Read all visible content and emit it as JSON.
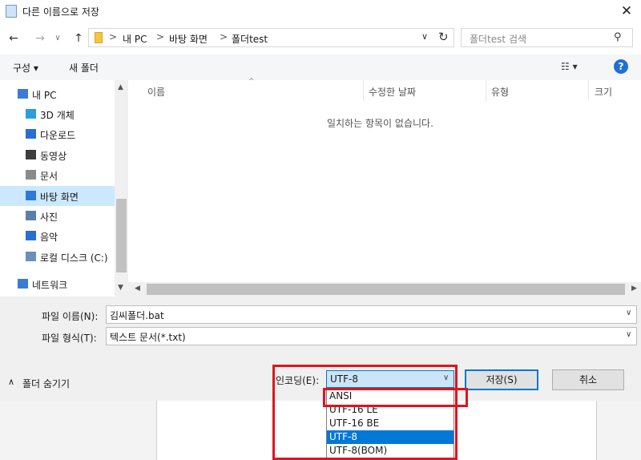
{
  "window": {
    "title": "다른 이름으로 저장",
    "close_label": "✕"
  },
  "nav": {
    "back": "←",
    "forward": "→",
    "dropdown": "∨",
    "up": "↑"
  },
  "address": {
    "crumbs": [
      "내 PC",
      "바탕 화면",
      "폴더test"
    ],
    "separator": ">",
    "chevron": "∨",
    "refresh": "↻"
  },
  "search": {
    "placeholder": "폴더test 검색",
    "icon": "⚲"
  },
  "toolbar": {
    "organize": "구성 ▾",
    "new_folder": "새 폴더",
    "view": "☷ ▾",
    "help": "?"
  },
  "tree": {
    "items": [
      {
        "label": "내 PC",
        "icon": "computer-icon",
        "color": "#3a7bd5"
      },
      {
        "label": "3D 개체",
        "icon": "cube-icon",
        "color": "#2aa0d8"
      },
      {
        "label": "다운로드",
        "icon": "download-icon",
        "color": "#2a6fd0"
      },
      {
        "label": "동영상",
        "icon": "film-icon",
        "color": "#3d3d3d"
      },
      {
        "label": "문서",
        "icon": "document-icon",
        "color": "#8a8a8a"
      },
      {
        "label": "바탕 화면",
        "icon": "desktop-icon",
        "color": "#2d7ad6"
      },
      {
        "label": "사진",
        "icon": "picture-icon",
        "color": "#5b7fa8"
      },
      {
        "label": "음악",
        "icon": "music-icon",
        "color": "#2a6fd0"
      },
      {
        "label": "로컬 디스크 (C:)",
        "icon": "drive-icon",
        "color": "#6a8fb8"
      },
      {
        "label": "네트워크",
        "icon": "network-icon",
        "color": "#3a7bd5"
      }
    ],
    "selected_index": 5
  },
  "columns": [
    "이름",
    "수정한 날짜",
    "유형",
    "크기"
  ],
  "empty_message": "일치하는 항목이 없습니다.",
  "form": {
    "filename_label": "파일 이름(N):",
    "filename_value": "김씨폴더.bat",
    "filetype_label": "파일 형식(T):",
    "filetype_value": "텍스트 문서(*.txt)",
    "hide_folders": "폴더 숨기기",
    "hide_chevron": "∧",
    "encoding_label": "인코딩(E):",
    "encoding_value": "UTF-8",
    "encoding_chevron": "∨",
    "save_button": "저장(S)",
    "cancel_button": "취소"
  },
  "encoding_options": [
    "ANSI",
    "UTF-16 LE",
    "UTF-16 BE",
    "UTF-8",
    "UTF-8(BOM)"
  ],
  "encoding_selected_index": 3,
  "colors": {
    "accent": "#0078d7",
    "highlight": "#e0141e",
    "tree_selected": "#cce8ff"
  }
}
